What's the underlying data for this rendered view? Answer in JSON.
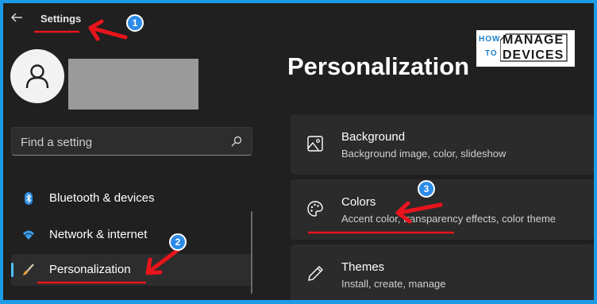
{
  "window": {
    "title": "Settings"
  },
  "search": {
    "placeholder": "Find a setting"
  },
  "nav": {
    "items": [
      {
        "label": "Bluetooth & devices",
        "icon": "bluetooth-icon"
      },
      {
        "label": "Network & internet",
        "icon": "wifi-icon"
      },
      {
        "label": "Personalization",
        "icon": "brush-icon",
        "active": true
      }
    ]
  },
  "logo": {
    "line1a": "HOW",
    "line1b": "TO",
    "line2a": "MANAGE",
    "line2b": "DEVICES"
  },
  "main": {
    "title": "Personalization",
    "cards": [
      {
        "title": "Background",
        "description": "Background image, color, slideshow",
        "icon": "image-icon"
      },
      {
        "title": "Colors",
        "description": "Accent color, transparency effects, color theme",
        "icon": "palette-icon"
      },
      {
        "title": "Themes",
        "description": "Install, create, manage",
        "icon": "pen-icon"
      }
    ]
  },
  "annotations": {
    "badges": [
      "1",
      "2",
      "3"
    ],
    "arrow_color": "#e8141c",
    "badge_color": "#2d8ce8"
  },
  "colors": {
    "accent": "#4cc2ff",
    "window_bg": "#202020",
    "card_bg": "#2b2b2b",
    "frame": "#1e9be6"
  }
}
